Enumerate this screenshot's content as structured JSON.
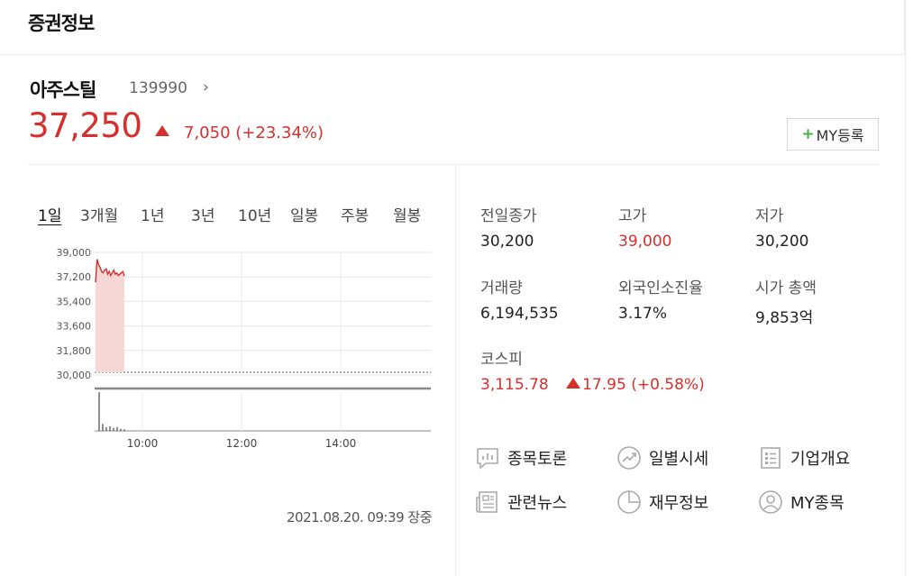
{
  "header": {
    "title": "증권정보"
  },
  "stock": {
    "name": "아주스틸",
    "code": "139990",
    "chevron": "›",
    "price": "37,250",
    "change": "7,050",
    "change_pct": "(+23.34%)",
    "my_button": "MY등록",
    "my_plus": "+"
  },
  "tabs": [
    "1일",
    "3개월",
    "1년",
    "3년",
    "10년",
    "일봉",
    "주봉",
    "월봉"
  ],
  "chart_data": {
    "type": "area",
    "y_ticks": [
      "39,000",
      "37,200",
      "35,400",
      "33,600",
      "31,800",
      "30,000"
    ],
    "x_ticks": [
      "10:00",
      "12:00",
      "14:00"
    ],
    "ylim": [
      30000,
      39000
    ],
    "previous_close": 30200,
    "series": [
      {
        "values": [
          36800,
          38500,
          38100,
          37900,
          37600,
          37500,
          37700,
          37800,
          37400,
          37600,
          37300,
          37500,
          37700,
          37400,
          37500,
          37300,
          37400,
          37500,
          37600,
          37250
        ]
      }
    ],
    "volume": [
      1.0,
      0.18,
      0.1,
      0.12,
      0.08,
      0.1,
      0.05,
      0.04
    ]
  },
  "timestamp": "2021.08.20. 09:39 장중",
  "stats": [
    {
      "label": "전일종가",
      "value": "30,200",
      "red": false
    },
    {
      "label": "고가",
      "value": "39,000",
      "red": true
    },
    {
      "label": "저가",
      "value": "30,200",
      "red": false
    },
    {
      "label": "거래량",
      "value": "6,194,535",
      "red": false
    },
    {
      "label": "외국인소진율",
      "value": "3.17%",
      "red": false
    },
    {
      "label": "시가 총액",
      "value": "9,853억",
      "red": false
    }
  ],
  "kospi": {
    "label": "코스피",
    "value": "3,115.78",
    "change": "17.95",
    "change_pct": "(+0.58%)"
  },
  "links": [
    {
      "label": "종목토론",
      "icon": "chat-chart-icon"
    },
    {
      "label": "일별시세",
      "icon": "trend-circle-icon"
    },
    {
      "label": "기업개요",
      "icon": "document-list-icon"
    },
    {
      "label": "관련뉴스",
      "icon": "news-icon"
    },
    {
      "label": "재무정보",
      "icon": "pie-chart-icon"
    },
    {
      "label": "MY종목",
      "icon": "user-circle-icon"
    }
  ],
  "colors": {
    "up_red": "#d6302e",
    "plus_green": "#4caf50"
  }
}
